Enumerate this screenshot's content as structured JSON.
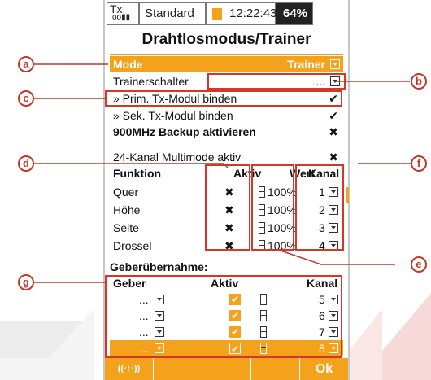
{
  "statusbar": {
    "tx": "Tx",
    "signal": "oo▮▮",
    "model": "Standard",
    "time": "12:22:43",
    "battery": "64%"
  },
  "title": "Drahtlosmodus/Trainer",
  "mode": {
    "label": "Mode",
    "value": "Trainer"
  },
  "trainerschalter": {
    "label": "Trainerschalter",
    "value": "..."
  },
  "prim": {
    "label": "» Prim. Tx-Modul binden",
    "mark": "✔"
  },
  "sek": {
    "label": "» Sek. Tx-Modul binden",
    "mark": "✔"
  },
  "backup": {
    "label": "900MHz Backup aktivieren",
    "mark": "✖"
  },
  "multimode": {
    "label": "24-Kanal Multimode aktiv",
    "mark": "✖"
  },
  "table1": {
    "headers": {
      "funktion": "Funktion",
      "aktiv": "Aktiv",
      "wert": "Wert",
      "kanal": "Kanal"
    },
    "rows": [
      {
        "funktion": "Quer",
        "aktiv": "✖",
        "wert": "100%",
        "kanal": "1"
      },
      {
        "funktion": "Höhe",
        "aktiv": "✖",
        "wert": "100%",
        "kanal": "2"
      },
      {
        "funktion": "Seite",
        "aktiv": "✖",
        "wert": "100%",
        "kanal": "3"
      },
      {
        "funktion": "Drossel",
        "aktiv": "✖",
        "wert": "100%",
        "kanal": "4"
      }
    ]
  },
  "geber": {
    "title": "Geberübernahme:",
    "headers": {
      "geber": "Geber",
      "aktiv": "Aktiv",
      "kanal": "Kanal"
    },
    "rows": [
      {
        "geber": "...",
        "kanal": "5"
      },
      {
        "geber": "...",
        "kanal": "6"
      },
      {
        "geber": "...",
        "kanal": "7"
      },
      {
        "geber": "...",
        "kanal": "8"
      }
    ]
  },
  "softkeys": {
    "wireless": "((·↑·))",
    "ok": "Ok"
  },
  "callouts": [
    "a",
    "b",
    "c",
    "d",
    "e",
    "f",
    "g"
  ],
  "colors": {
    "accent": "#f4a21c",
    "callout": "#c0392b"
  }
}
